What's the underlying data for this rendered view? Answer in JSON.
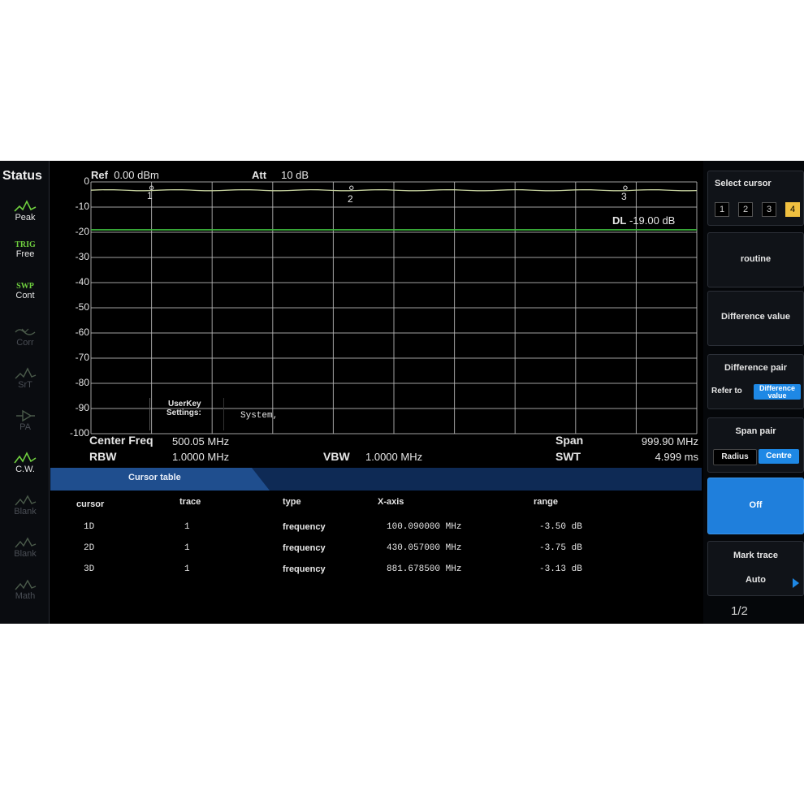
{
  "status": {
    "title": "Status",
    "items": [
      {
        "top": "",
        "label": "Peak",
        "icon": "peak-icon",
        "state": "active"
      },
      {
        "top": "TRIG",
        "label": "Free",
        "icon": "",
        "state": "active"
      },
      {
        "top": "SWP",
        "label": "Cont",
        "icon": "",
        "state": "active"
      },
      {
        "top": "",
        "label": "Corr",
        "icon": "corr-icon",
        "state": "dim"
      },
      {
        "top": "",
        "label": "SrT",
        "icon": "srt-icon",
        "state": "dim"
      },
      {
        "top": "",
        "label": "PA",
        "icon": "pa-icon",
        "state": "dim"
      },
      {
        "top": "",
        "label": "C.W.",
        "icon": "cw-icon",
        "state": "active"
      },
      {
        "top": "",
        "label": "Blank",
        "icon": "blank-icon",
        "state": "dim"
      },
      {
        "top": "",
        "label": "Blank",
        "icon": "blank-icon",
        "state": "dim"
      },
      {
        "top": "",
        "label": "Math",
        "icon": "math-icon",
        "state": "dim"
      }
    ]
  },
  "plot": {
    "ref_label": "Ref",
    "ref_value": "0.00 dBm",
    "att_label": "Att",
    "att_value": "10 dB",
    "y_ticks": [
      "0",
      "-10",
      "-20",
      "-30",
      "-40",
      "-50",
      "-60",
      "-70",
      "-80",
      "-90",
      "-100"
    ],
    "markers": [
      "1",
      "2",
      "3"
    ],
    "display_line_label": "DL",
    "display_line_value": "-19.00 dB",
    "display_line_level": -19.0,
    "trace_level": -3.3,
    "trace_color": "#c8d4a0",
    "display_line_color": "#3fbf3f",
    "grid_color": "#bdbdbd"
  },
  "userkey": {
    "label_line1": "UserKey",
    "label_line2": "Settings:",
    "value": "System,"
  },
  "info": {
    "center_freq_label": "Center Freq",
    "center_freq_value": "500.05 MHz",
    "rbw_label": "RBW",
    "rbw_value": "1.0000 MHz",
    "vbw_label": "VBW",
    "vbw_value": "1.0000 MHz",
    "span_label": "Span",
    "span_value": "999.90 MHz",
    "swt_label": "SWT",
    "swt_value": "4.999 ms"
  },
  "cursor_table": {
    "tab_label": "Cursor table",
    "headers": [
      "cursor",
      "trace",
      "type",
      "X-axis",
      "range"
    ],
    "rows": [
      {
        "cursor": "1D",
        "trace": "1",
        "type": "frequency",
        "x_axis": "100.090000 MHz",
        "range": "-3.50 dB"
      },
      {
        "cursor": "2D",
        "trace": "1",
        "type": "frequency",
        "x_axis": "430.057000 MHz",
        "range": "-3.75 dB"
      },
      {
        "cursor": "3D",
        "trace": "1",
        "type": "frequency",
        "x_axis": "881.678500 MHz",
        "range": "-3.13 dB"
      }
    ]
  },
  "softkeys": {
    "select_cursor_label": "Select cursor",
    "cursor_numbers": [
      "1",
      "2",
      "3",
      "4"
    ],
    "selected_cursor": "4",
    "routine_label": "routine",
    "difference_value_label": "Difference value",
    "difference_pair_label": "Difference pair",
    "refer_to_label": "Refer to",
    "difference_value_pill": "Difference value",
    "span_pair_label": "Span pair",
    "radius_label": "Radius",
    "centre_label": "Centre",
    "off_label": "Off",
    "mark_trace_label": "Mark trace",
    "mark_trace_value": "Auto",
    "page_indicator": "1/2",
    "accent_color": "#1f7fdc",
    "highlight_color": "#1e88e5"
  }
}
